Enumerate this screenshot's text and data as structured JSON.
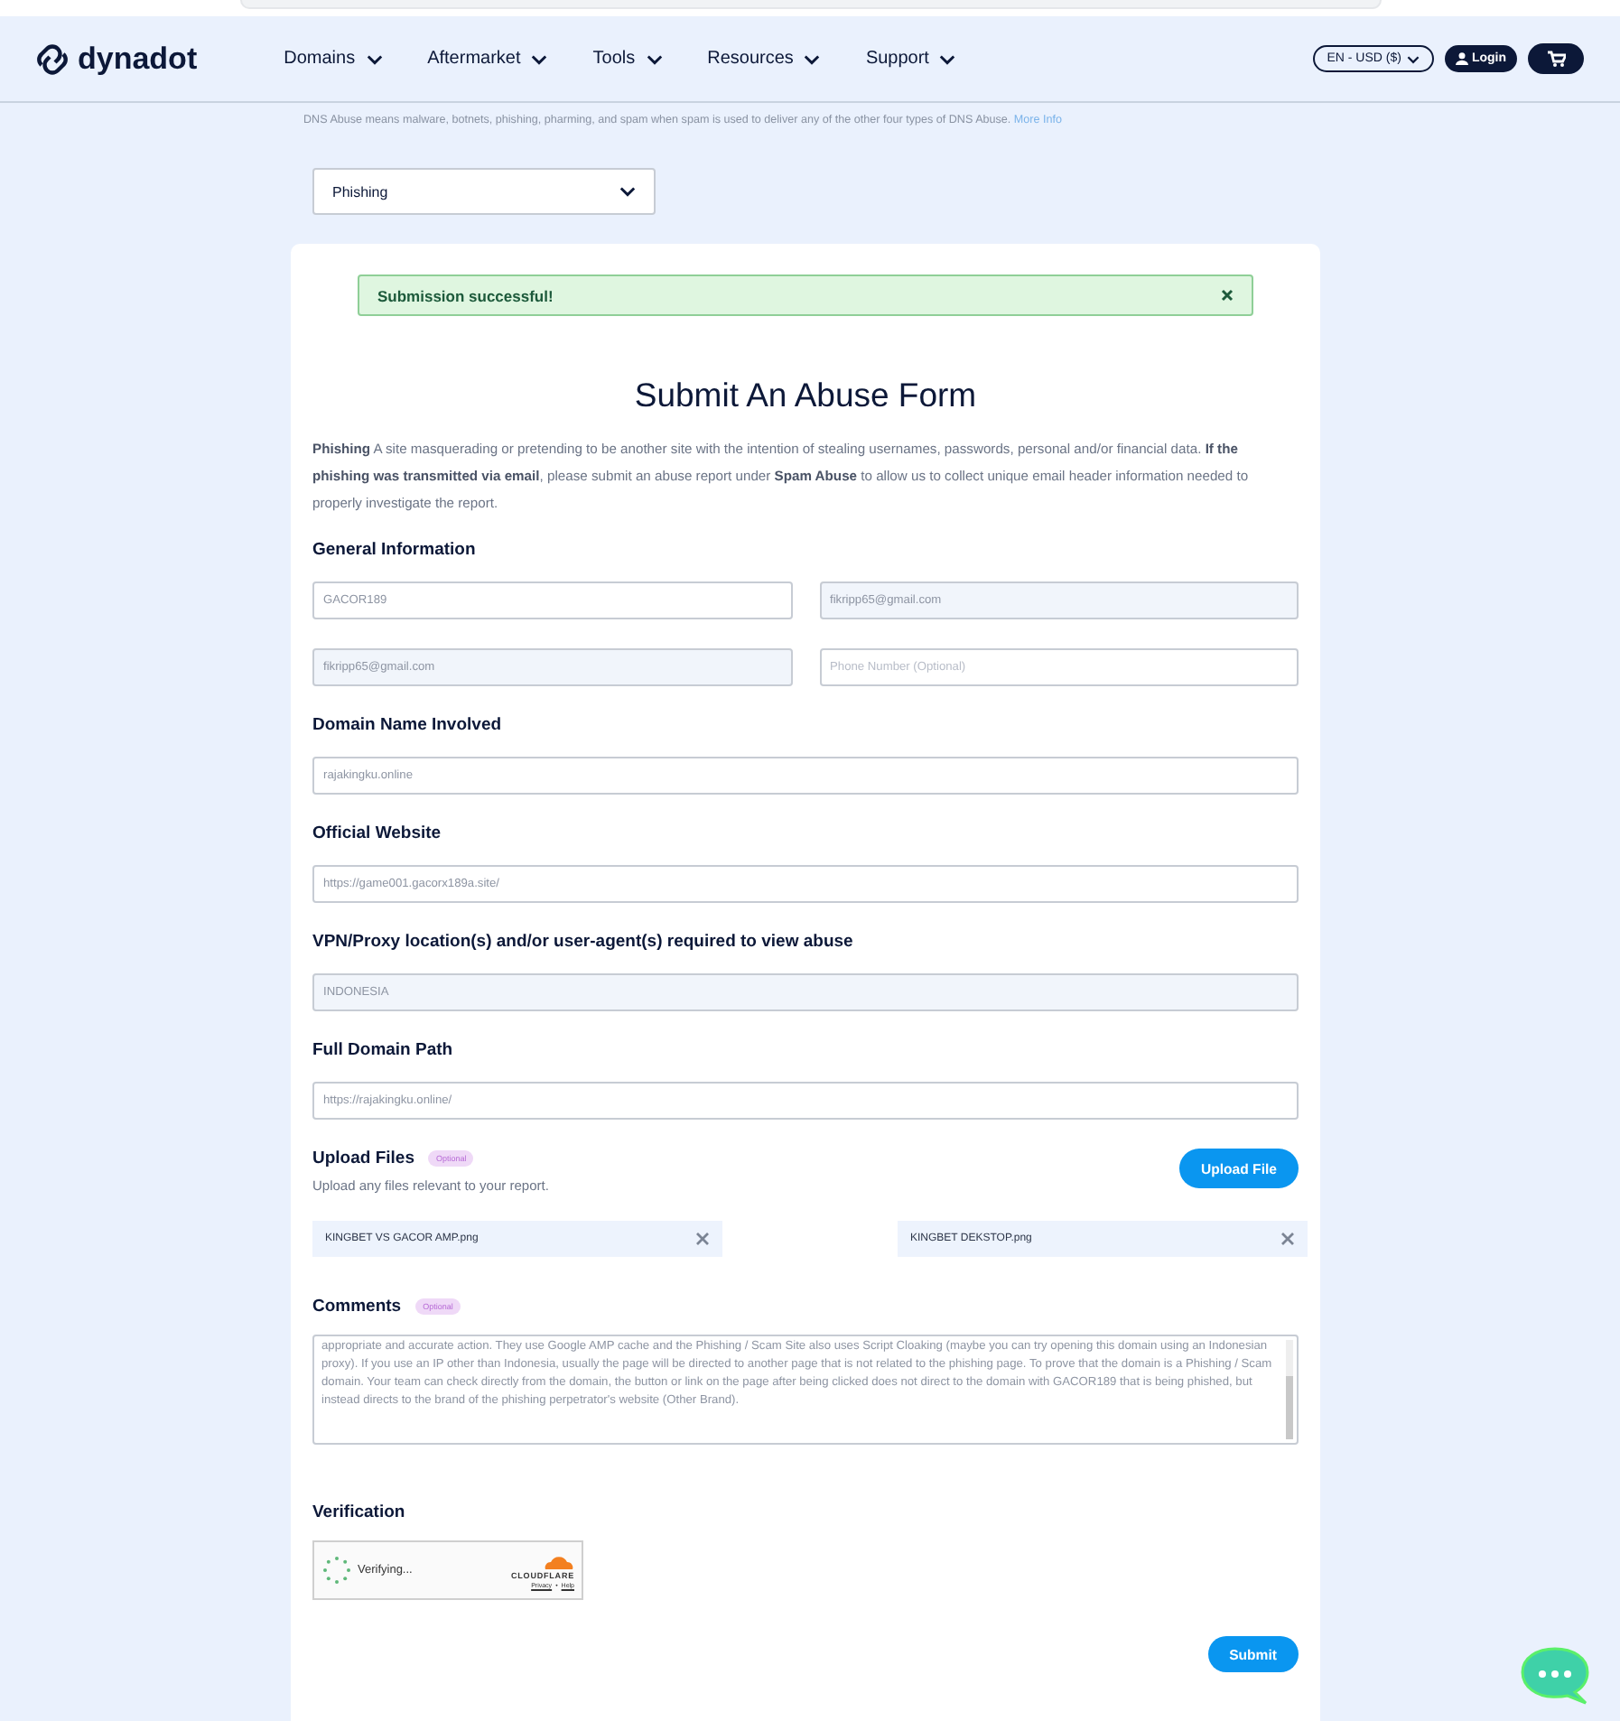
{
  "header": {
    "logo": "dynadot",
    "nav": [
      {
        "label": "Domains"
      },
      {
        "label": "Aftermarket"
      },
      {
        "label": "Tools"
      },
      {
        "label": "Resources"
      },
      {
        "label": "Support"
      }
    ],
    "language": "EN - USD ($)",
    "login": "Login"
  },
  "intro": {
    "text": "DNS Abuse means malware, botnets, phishing, pharming, and spam when spam is used to deliver any of the other four types of DNS Abuse.",
    "link": "More Info"
  },
  "abuse_type": {
    "value": "Phishing"
  },
  "alert": {
    "message": "Submission successful!"
  },
  "form": {
    "title": "Submit An Abuse Form",
    "description": "**Phishing** A site masquerading or pretending to be another site with the intention of stealing usernames, passwords, personal and/or financial data. **If the phishing was transmitted via email**, please submit an abuse report under **Spam Abuse** to allow us to collect unique email header information needed to properly investigate the report.",
    "sections": [
      {
        "heading": "General Information",
        "rows": [
          [
            {
              "value": "GACOR189",
              "disabled": false
            },
            {
              "value": "fikripp65@gmail.com",
              "disabled": true
            }
          ],
          [
            {
              "value": "fikripp65@gmail.com",
              "disabled": true
            },
            {
              "placeholder": "Phone Number (Optional)",
              "disabled": false
            }
          ]
        ]
      },
      {
        "heading": "Domain Name Involved",
        "rows": [
          [
            {
              "value": "rajakingku.online",
              "disabled": false
            }
          ]
        ]
      },
      {
        "heading": "Official Website",
        "rows": [
          [
            {
              "value": "https://game001.gacorx189a.site/",
              "disabled": false
            }
          ]
        ]
      },
      {
        "heading": "VPN/Proxy location(s) and/or user-agent(s) required to view abuse",
        "rows": [
          [
            {
              "value": "INDONESIA",
              "disabled": true
            }
          ]
        ]
      },
      {
        "heading": "Full Domain Path",
        "rows": [
          [
            {
              "value": "https://rajakingku.online/",
              "disabled": false
            }
          ]
        ]
      }
    ],
    "upload": {
      "heading": "Upload Files",
      "badge": "Optional",
      "hint": "Upload any files relevant to your report.",
      "button": "Upload File",
      "files": [
        {
          "name": "KINGBET VS GACOR AMP.png"
        },
        {
          "name": "KINGBET DEKSTOP.png"
        }
      ]
    },
    "comments": {
      "heading": "Comments",
      "badge": "Optional",
      "value": "appropriate and accurate action. They use Google AMP cache and the Phishing / Scam Site also uses Script Cloaking (maybe you can try opening this domain using an Indonesian proxy). If you use an IP other than Indonesia, usually the page will be directed to another page that is not related to the phishing page. To prove that the domain is a Phishing / Scam domain. Your team can check directly from the domain, the button or link on the page after being clicked does not direct to the domain with GACOR189 that is being phished, but instead directs to the brand of the phishing perpetrator's website (Other Brand)."
    },
    "verification": {
      "heading": "Verification",
      "status": "Verifying...",
      "brand": "CLOUDFLARE",
      "links": [
        "Privacy",
        "Help"
      ],
      "separator": "•"
    },
    "submit": "Submit"
  }
}
